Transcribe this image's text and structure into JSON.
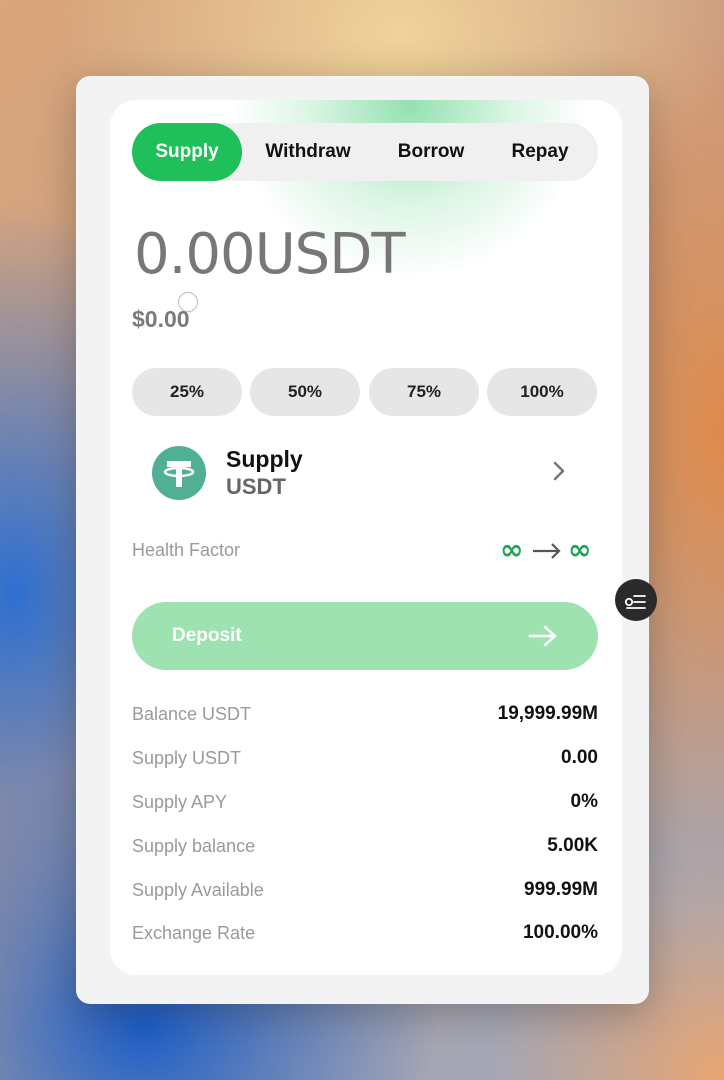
{
  "tabs": [
    {
      "label": "Supply",
      "active": true
    },
    {
      "label": "Withdraw",
      "active": false
    },
    {
      "label": "Borrow",
      "active": false
    },
    {
      "label": "Repay",
      "active": false
    }
  ],
  "amount": {
    "value": "0.00USDT",
    "usd": "$0.00"
  },
  "percent_buttons": [
    "25%",
    "50%",
    "75%",
    "100%"
  ],
  "asset": {
    "title": "Supply",
    "symbol": "USDT",
    "icon": "tether-icon",
    "icon_color": "#50af95"
  },
  "health_factor": {
    "label": "Health Factor",
    "from": "∞",
    "to": "∞"
  },
  "deposit": {
    "label": "Deposit"
  },
  "info": [
    {
      "label": "Balance USDT",
      "value": "19,999.99M"
    },
    {
      "label": "Supply USDT",
      "value": "0.00"
    },
    {
      "label": "Supply APY",
      "value": "0%"
    },
    {
      "label": "Supply balance",
      "value": "5.00K"
    },
    {
      "label": "Supply Available",
      "value": "999.99M"
    },
    {
      "label": "Exchange Rate",
      "value": "100.00%"
    }
  ],
  "colors": {
    "accent": "#1fbf5a",
    "accent_disabled": "#9fe2b2",
    "health_factor": "#1fa653"
  }
}
